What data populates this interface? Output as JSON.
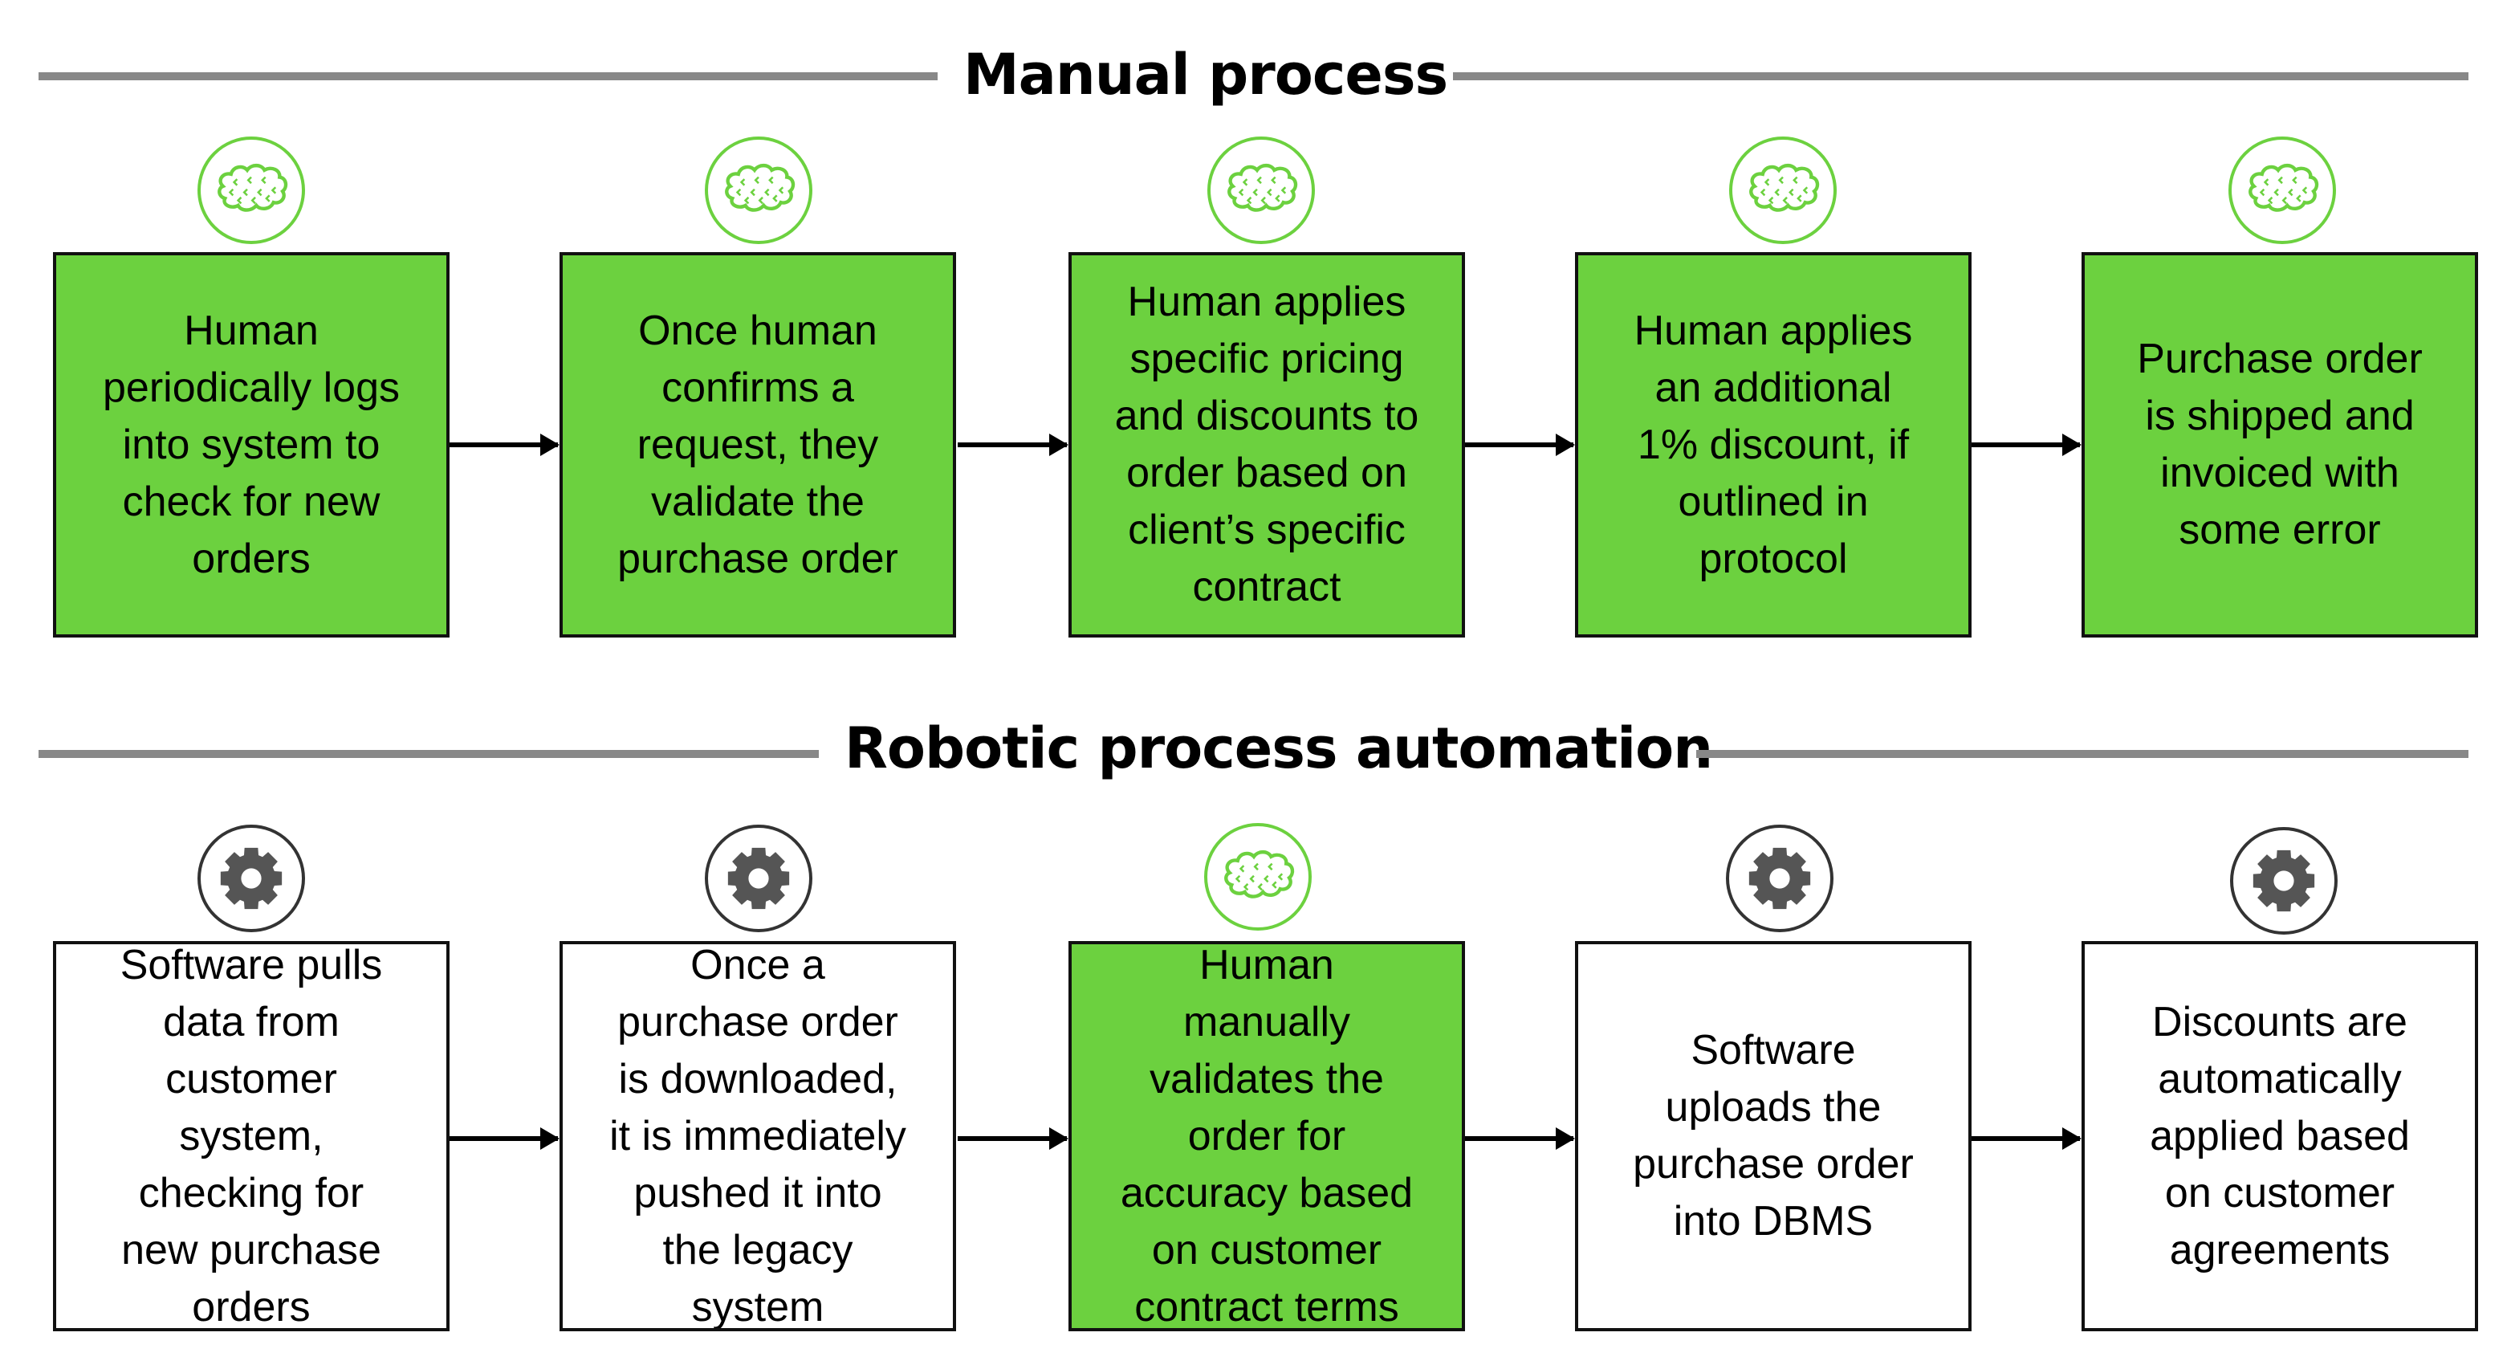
{
  "colors": {
    "human_green": "#6cd13f",
    "software_white": "#ffffff",
    "divider_gray": "#888888",
    "gear_gray": "#555555"
  },
  "sections": [
    {
      "title": "Manual process",
      "steps": [
        {
          "icon": "brain-icon",
          "style": "human",
          "text": "Human\nperiodically logs\ninto system to\ncheck for new\norders"
        },
        {
          "icon": "brain-icon",
          "style": "human",
          "text": "Once human\nconfirms a\nrequest, they\nvalidate the\npurchase order"
        },
        {
          "icon": "brain-icon",
          "style": "human",
          "text": "Human applies\nspecific pricing\nand discounts to\norder based on\nclient’s specific\ncontract"
        },
        {
          "icon": "brain-icon",
          "style": "human",
          "text": "Human applies\nan additional\n1% discount, if\noutlined in\nprotocol"
        },
        {
          "icon": "brain-icon",
          "style": "human",
          "text": "Purchase order\nis shipped and\ninvoiced with\nsome error"
        }
      ]
    },
    {
      "title": "Robotic process automation",
      "steps": [
        {
          "icon": "gear-icon",
          "style": "software",
          "text": "Software pulls\ndata from\ncustomer\nsystem,\nchecking for\nnew purchase\norders"
        },
        {
          "icon": "gear-icon",
          "style": "software",
          "text": "Once a\npurchase order\nis downloaded,\nit is immediately\npushed it into\nthe legacy\nsystem"
        },
        {
          "icon": "brain-icon",
          "style": "human",
          "text": "Human\nmanually\nvalidates the\norder for\naccuracy based\non customer\ncontract terms"
        },
        {
          "icon": "gear-icon",
          "style": "software",
          "text": "Software\nuploads the\npurchase order\ninto DBMS"
        },
        {
          "icon": "gear-icon",
          "style": "software",
          "text": "Discounts are\nautomatically\napplied based\non customer\nagreements"
        }
      ]
    }
  ]
}
